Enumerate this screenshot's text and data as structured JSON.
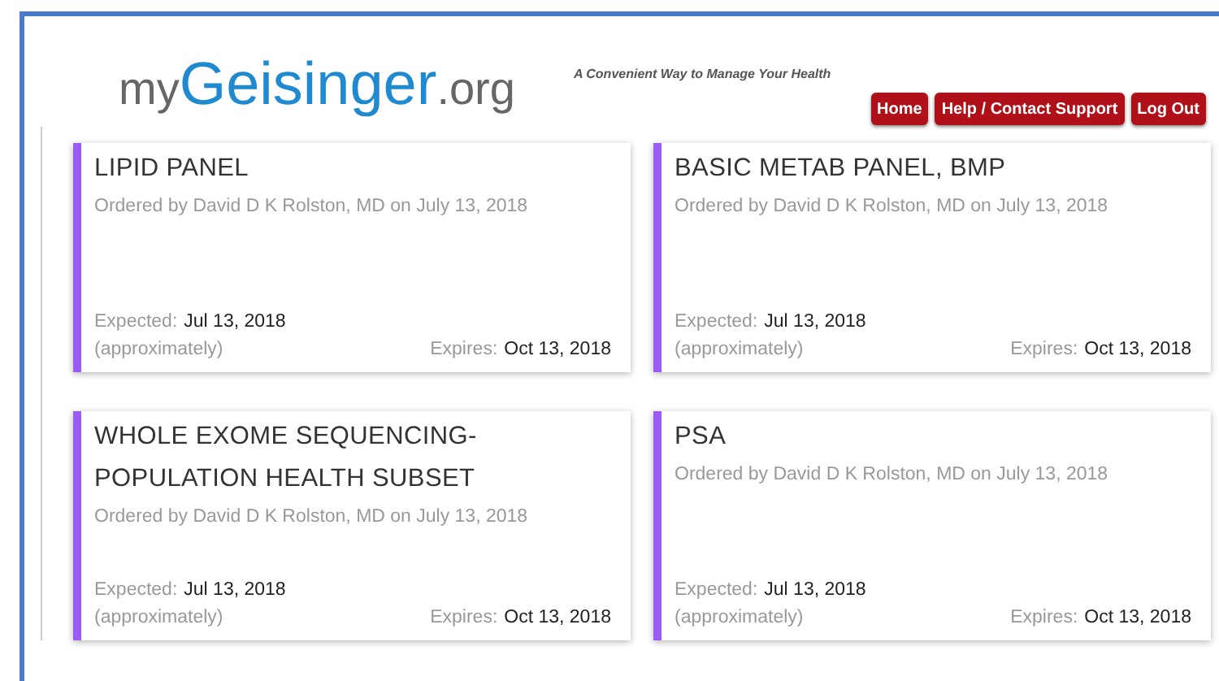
{
  "header": {
    "logo": [
      "my",
      "Geisinger",
      ".org"
    ],
    "tagline": "A Convenient Way to Manage Your Health",
    "buttons": [
      "Home",
      "Help / Contact Support",
      "Log Out"
    ]
  },
  "orders": [
    {
      "title": "LIPID PANEL",
      "ordered": "Ordered by David D K Rolston, MD on July 13, 2018",
      "expected_label": "Expected:",
      "expected": "Jul 13, 2018",
      "approx": "(approximately)",
      "expires_label": "Expires:",
      "expires": "Oct 13, 2018"
    },
    {
      "title": "BASIC METAB PANEL, BMP",
      "ordered": "Ordered by David D K Rolston, MD on July 13, 2018",
      "expected_label": "Expected:",
      "expected": "Jul 13, 2018",
      "approx": "(approximately)",
      "expires_label": "Expires:",
      "expires": "Oct 13, 2018"
    },
    {
      "title": "WHOLE EXOME SEQUENCING-POPULATION HEALTH SUBSET",
      "ordered": "Ordered by David D K Rolston, MD on July 13, 2018",
      "expected_label": "Expected:",
      "expected": "Jul 13, 2018",
      "approx": "(approximately)",
      "expires_label": "Expires:",
      "expires": "Oct 13, 2018"
    },
    {
      "title": "PSA",
      "ordered": "Ordered by David D K Rolston, MD on July 13, 2018",
      "expected_label": "Expected:",
      "expected": "Jul 13, 2018",
      "approx": "(approximately)",
      "expires_label": "Expires:",
      "expires": "Oct 13, 2018"
    }
  ]
}
